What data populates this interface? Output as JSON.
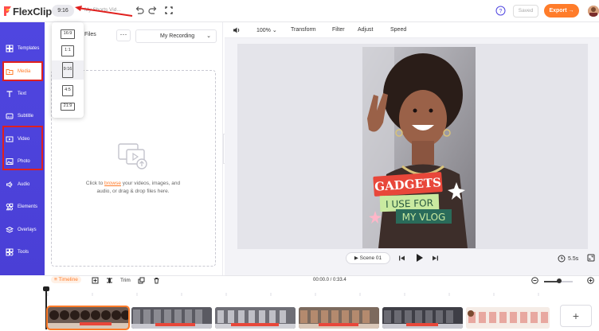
{
  "app": {
    "logo_text": "FlexClip",
    "brand_color": "#4f46e0",
    "accent_color": "#ff7c2a"
  },
  "topbar": {
    "aspect_ratio": "9:16",
    "project_name": "My Shorts Vid...",
    "saved_label": "Saved",
    "export_label": "Export →"
  },
  "ratio_menu": {
    "options": [
      "16:9",
      "1:1",
      "9:16",
      "4:5",
      "21:9"
    ],
    "selected": "9:16"
  },
  "sidebar": {
    "items": [
      {
        "label": "Templates",
        "icon": "templates-icon"
      },
      {
        "label": "Media",
        "icon": "media-folder-icon",
        "active": true
      },
      {
        "label": "Text",
        "icon": "text-icon"
      },
      {
        "label": "Subtitle",
        "icon": "subtitle-icon"
      },
      {
        "label": "Video",
        "icon": "video-icon"
      },
      {
        "label": "Photo",
        "icon": "photo-icon"
      },
      {
        "label": "Audio",
        "icon": "audio-icon"
      },
      {
        "label": "Elements",
        "icon": "elements-icon"
      },
      {
        "label": "Overlays",
        "icon": "overlays-icon"
      },
      {
        "label": "Tools",
        "icon": "tools-icon"
      }
    ]
  },
  "media_panel": {
    "tab_label": "Files",
    "source_select": "My Recording",
    "upload_prefix": "Click to ",
    "upload_link": "browse",
    "upload_suffix": " your videos, images, and audio, or drag & drop files here."
  },
  "editor_toolbar": {
    "zoom": "100%",
    "transform": "Transform",
    "filter": "Filter",
    "adjust": "Adjust",
    "speed": "Speed"
  },
  "video_overlay": {
    "line1": "GADGETS",
    "line2": "I USE FOR",
    "line3": "MY VLOG"
  },
  "playback": {
    "scene_label": "Scene 01",
    "duration": "5.5s"
  },
  "timeline": {
    "label": "Timeline",
    "trim_label": "Trim",
    "timecode": "00:00.0 / 0:33.4",
    "zoom_level": 0.5
  }
}
